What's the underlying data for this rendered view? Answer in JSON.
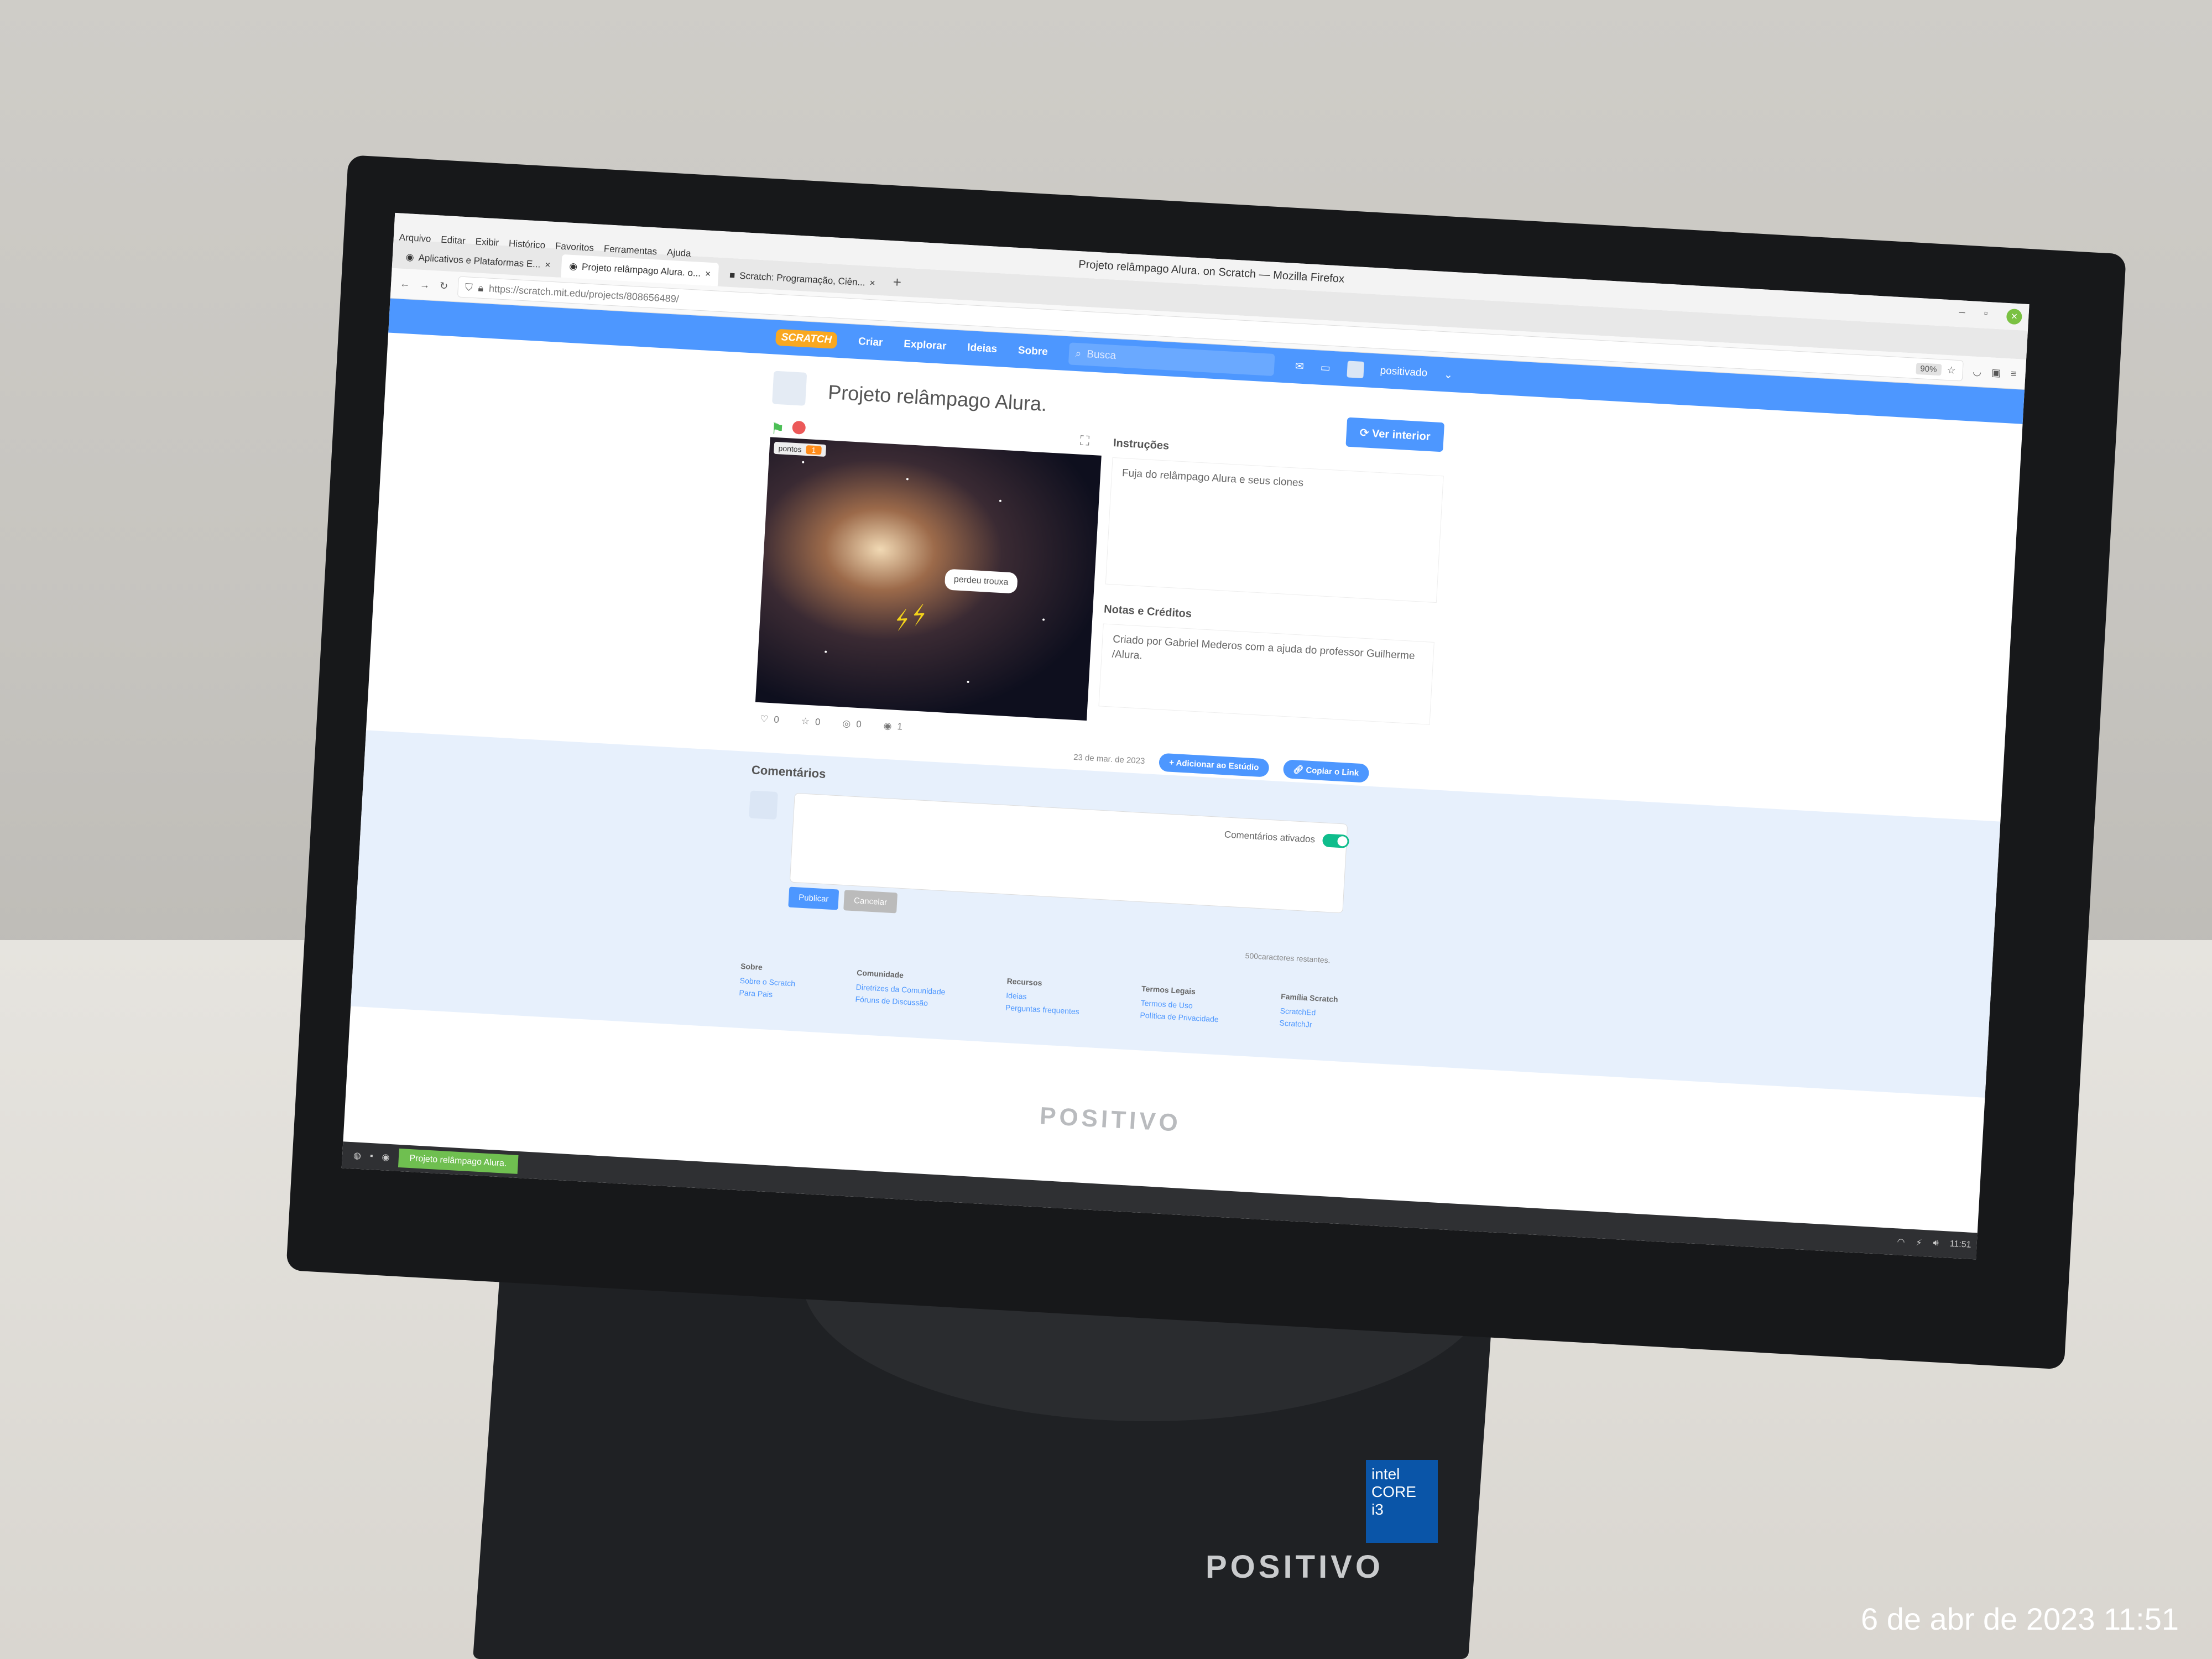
{
  "window": {
    "title": "Projeto relâmpago Alura. on Scratch — Mozilla Firefox",
    "menu": [
      "Arquivo",
      "Editar",
      "Exibir",
      "Histórico",
      "Favoritos",
      "Ferramentas",
      "Ajuda"
    ]
  },
  "tabs": [
    {
      "label": "Aplicativos e Plataformas E..."
    },
    {
      "label": "Projeto relâmpago Alura. o..."
    },
    {
      "label": "Scratch: Programação, Ciên..."
    }
  ],
  "address": {
    "url": "https://scratch.mit.edu/projects/808656489/",
    "zoom": "90%"
  },
  "scratch_nav": {
    "logo": "SCRATCH",
    "items": [
      "Criar",
      "Explorar",
      "Ideias",
      "Sobre"
    ],
    "search_placeholder": "Busca",
    "username": "positivado"
  },
  "project": {
    "title": "Projeto relâmpago Alura.",
    "see_inside": "Ver interior",
    "variable_name": "pontos",
    "variable_value": "1",
    "speech_text": "perdeu trouxa",
    "instructions_title": "Instruções",
    "instructions_text": "Fuja do relâmpago Alura e seus clones",
    "notes_title": "Notas e Créditos",
    "notes_text": "Criado por Gabriel Mederos com a ajuda do professor Guilherme /Alura.",
    "stats": {
      "loves": "0",
      "favorites": "0",
      "remixes": "0",
      "views": "1"
    },
    "date": "23 de mar. de 2023",
    "add_to_studio": "Adicionar ao Estúdio",
    "copy_link": "Copiar o Link"
  },
  "comments": {
    "title": "Comentários",
    "toggle_label": "Comentários ativados",
    "post": "Publicar",
    "cancel": "Cancelar",
    "chars_left": "500caracteres restantes."
  },
  "footer": {
    "columns": [
      {
        "title": "Sobre",
        "links": [
          "Sobre o Scratch",
          "Para Pais"
        ]
      },
      {
        "title": "Comunidade",
        "links": [
          "Diretrizes da Comunidade",
          "Fóruns de Discussão"
        ]
      },
      {
        "title": "Recursos",
        "links": [
          "Ideias",
          "Perguntas frequentes"
        ]
      },
      {
        "title": "Termos Legais",
        "links": [
          "Termos de Uso",
          "Política de Privacidade"
        ]
      },
      {
        "title": "Família Scratch",
        "links": [
          "ScratchEd",
          "ScratchJr"
        ]
      }
    ]
  },
  "taskbar": {
    "active_task": "Projeto relâmpago Alura.",
    "clock": "11:51"
  },
  "hardware": {
    "monitor_brand": "POSITIVO",
    "case_brand": "POSITIVO",
    "intel_line1": "intel",
    "intel_line2": "CORE",
    "intel_line3": "i3"
  },
  "photo_date_stamp": "6 de abr de 2023 11:51"
}
